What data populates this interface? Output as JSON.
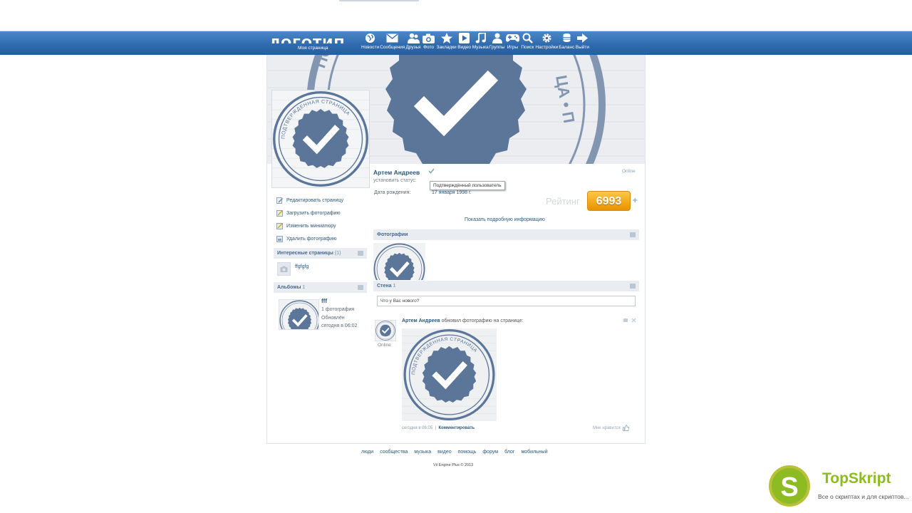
{
  "header": {
    "logo_text": "ЛОГОТИП",
    "my_page": "Моя страница",
    "nav": [
      {
        "icon": "globe-icon",
        "label": "Новости"
      },
      {
        "icon": "envelope-icon",
        "label": "Сообщения"
      },
      {
        "icon": "friends-icon",
        "label": "Друзья"
      },
      {
        "icon": "camera-icon",
        "label": "Фото"
      },
      {
        "icon": "star-icon",
        "label": "Закладки"
      },
      {
        "icon": "play-icon",
        "label": "Видео"
      },
      {
        "icon": "music-note-icon",
        "label": "Музыка"
      },
      {
        "icon": "group-icon",
        "label": "Группы"
      },
      {
        "icon": "gamepad-icon",
        "label": "Игры"
      },
      {
        "icon": "search-icon",
        "label": "Поиск"
      },
      {
        "icon": "gear-icon",
        "label": "Настройки"
      },
      {
        "icon": "coins-icon",
        "label": "Баланс"
      },
      {
        "icon": "arrow-right-icon",
        "label": "Выйти"
      }
    ]
  },
  "stamp_text": "ПОДТВЕРЖДЕННАЯ СТРАНИЦА",
  "profile": {
    "name": "Артем Андреев",
    "online": "Online",
    "status_placeholder": "установить статус:",
    "verified_tooltip": "Подтверждённый пользователь",
    "birthday_label": "Дата рождения:",
    "birthday_value": "17 января 1998 г.",
    "rating_label": "Рейтинг",
    "rating_value": "6993",
    "rating_plus": "+",
    "show_info": "Показать подробную информацию"
  },
  "menu": [
    {
      "icon": "edit-page-icon",
      "label": "Редактировать страницу"
    },
    {
      "icon": "upload-photo-icon",
      "label": "Загрузить фотографию"
    },
    {
      "icon": "thumbnail-icon",
      "label": "Изменить миниатюру"
    },
    {
      "icon": "delete-photo-icon",
      "label": "Удалить фотографию"
    }
  ],
  "interesting": {
    "title": "Интересные страницы",
    "count": "(1)",
    "item_name": "ffgfgfg"
  },
  "albums": {
    "title": "Альбомы",
    "count": "1",
    "album_name": "fff",
    "photo_count": "1 фотография",
    "updated": "Обновлён",
    "updated_time": "сегодня в 06:02"
  },
  "photos": {
    "title": "Фотографии"
  },
  "wall": {
    "title": "Стена",
    "count": "1",
    "input_value": "Что у Вас нового?"
  },
  "post": {
    "author": "Артем Андреев",
    "action": "обновил фотографию на странице:",
    "online": "Online",
    "time": "сегодня в 06:05",
    "separator": "|",
    "comment": "Комментировать",
    "like": "Мне нравится"
  },
  "footer": {
    "links": [
      "люди",
      "сообщества",
      "музыка",
      "видео",
      "помощь",
      "форум",
      "блог",
      "мобильный"
    ],
    "copyright": "Vii Engine Plus © 2013"
  },
  "watermark": {
    "letter": "S",
    "title": "TopSkript",
    "subtitle": "Все о скриптах и для скриптов..."
  },
  "colors": {
    "header_blue": "#2f69ad",
    "link_blue": "#2b587a",
    "stamp_blue": "#5b7699",
    "rating_orange": "#f0a20f",
    "topskript_green": "#8cbc21"
  }
}
